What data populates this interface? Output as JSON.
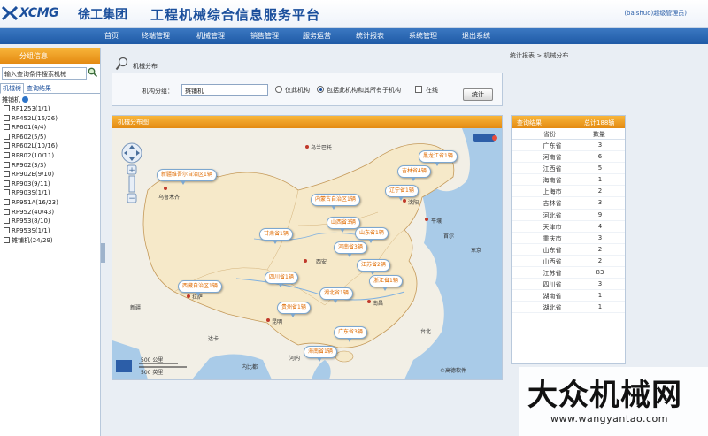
{
  "header": {
    "logo_text": "XCMG",
    "logo_cn": "徐工集团",
    "platform_title": "工程机械综合信息服务平台",
    "user": "(baishuo)超级管理员)"
  },
  "nav": {
    "items": [
      "首页",
      "终端管理",
      "机械管理",
      "销售管理",
      "服务运营",
      "统计报表",
      "系统管理",
      "退出系统"
    ]
  },
  "sidebar": {
    "title": "分组信息",
    "search_text": "输入查询条件搜索机械",
    "tabs": [
      "机械树",
      "查询结果"
    ],
    "root": "摊铺机",
    "items": [
      "RP1253(1/1)",
      "RP452L(16/26)",
      "RP601(4/4)",
      "RP602(5/5)",
      "RP602L(10/16)",
      "RP802(10/11)",
      "RP902(3/3)",
      "RP902E(9/10)",
      "RP903(9/11)",
      "RP903S(1/1)",
      "RP951A(16/23)",
      "RP952(40/43)",
      "RP953(8/10)",
      "RP953S(1/1)",
      "摊铺机(24/29)"
    ]
  },
  "breadcrumb": "统计报表 > 机械分布",
  "page_title": "机械分布",
  "query": {
    "label": "机构分组：",
    "value": "摊铺机",
    "option_self": "仅此机构",
    "option_all": "包括此机构和其所有子机构",
    "option_online": "在线",
    "button": "统计"
  },
  "map": {
    "title": "机械分布图",
    "scale_top": "500 公里",
    "scale_bottom": "500 英里",
    "copyright": "©高德软件",
    "places": [
      "乌兰巴托",
      "乌鲁木齐",
      "新疆",
      "拉萨",
      "达卡",
      "内比都",
      "河内",
      "西安",
      "昆明",
      "沈阳",
      "平壤",
      "首尔",
      "东京",
      "台北",
      "南昌"
    ],
    "bubbles": [
      "黑龙江省1辆",
      "吉林省4辆",
      "新疆维吾尔自治区1辆",
      "辽宁省1辆",
      "内蒙古自治区1辆",
      "山西省3辆",
      "甘肃省1辆",
      "山东省1辆",
      "河南省3辆",
      "江苏省2辆",
      "西藏自治区1辆",
      "四川省1辆",
      "浙江省1辆",
      "湖北省1辆",
      "贵州省1辆",
      "广东省3辆",
      "海南省1辆"
    ]
  },
  "stats": {
    "title": "查询结果",
    "total": "总计188辆",
    "col_province": "省份",
    "col_count": "数量",
    "rows": [
      {
        "province": "广东省",
        "count": "3"
      },
      {
        "province": "河南省",
        "count": "6"
      },
      {
        "province": "江西省",
        "count": "5"
      },
      {
        "province": "海南省",
        "count": "1"
      },
      {
        "province": "上海市",
        "count": "2"
      },
      {
        "province": "吉林省",
        "count": "3"
      },
      {
        "province": "河北省",
        "count": "9"
      },
      {
        "province": "天津市",
        "count": "4"
      },
      {
        "province": "重庆市",
        "count": "3"
      },
      {
        "province": "山东省",
        "count": "2"
      },
      {
        "province": "山西省",
        "count": "2"
      },
      {
        "province": "江苏省",
        "count": "83"
      },
      {
        "province": "四川省",
        "count": "3"
      },
      {
        "province": "湖南省",
        "count": "1"
      },
      {
        "province": "湖北省",
        "count": "1"
      }
    ]
  },
  "watermark": {
    "cn": "大众机械网",
    "url": "www.wangyantao.com"
  },
  "colors": {
    "brand_blue": "#1b4f9c",
    "orange_header": "#e48a12",
    "bubble_text": "#e06b00"
  }
}
